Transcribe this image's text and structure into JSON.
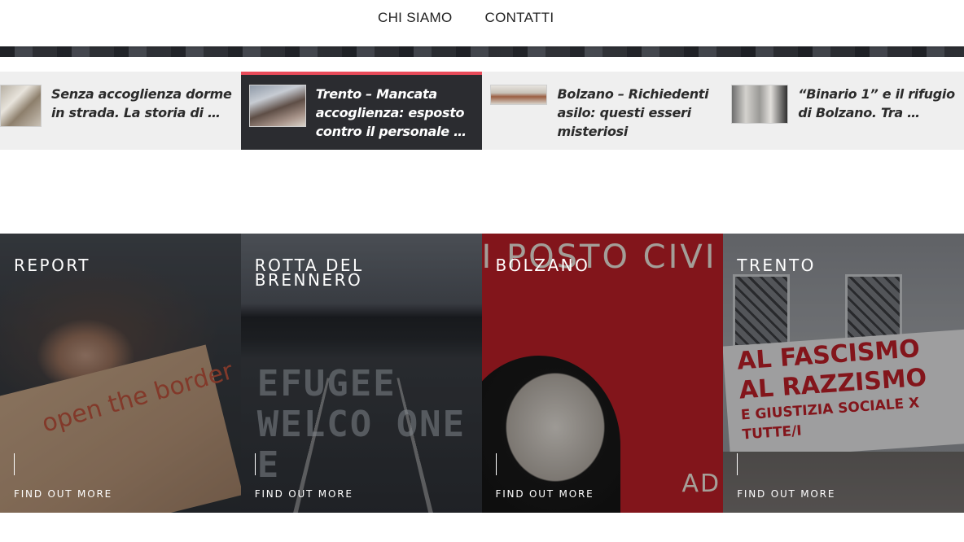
{
  "header": {
    "nav": [
      {
        "label": "CHI SIAMO"
      },
      {
        "label": "CONTATTI"
      }
    ]
  },
  "ticker": [
    {
      "title": "Senza accoglienza dorme in strada. La storia di …",
      "active": false
    },
    {
      "title": "Trento – Mancata accoglienza: esposto contro il personale …",
      "active": true
    },
    {
      "title": "Bolzano – Richiedenti asilo: questi esseri misteriosi",
      "active": false
    },
    {
      "title": "“Binario 1” e il rifugio di Bolzano. Tra …",
      "active": false
    }
  ],
  "tiles": [
    {
      "title": "REPORT",
      "cta": "FIND OUT MORE"
    },
    {
      "title": "ROTTA DEL BRENNERO",
      "cta": "FIND OUT MORE"
    },
    {
      "title": "BOLZANO",
      "cta": "FIND OUT MORE"
    },
    {
      "title": "TRENTO",
      "cta": "FIND OUT MORE"
    }
  ],
  "colors": {
    "accent": "#e94b5a",
    "active_bg": "#2b2c30",
    "ticker_bg": "#efefef",
    "bolzano_red": "#c01f28"
  },
  "image_text": {
    "report_sign": "open the border",
    "brennero_road": "EFUGEE WELCO ONE E",
    "bolzano_poster": "I POSTO CIVI",
    "bolzano_poster_2": "AD",
    "trento_banner_1": "AL FASCISMO",
    "trento_banner_2": "AL RAZZISMO",
    "trento_banner_3": "E GIUSTIZIA SOCIALE X TUTTE/I"
  }
}
